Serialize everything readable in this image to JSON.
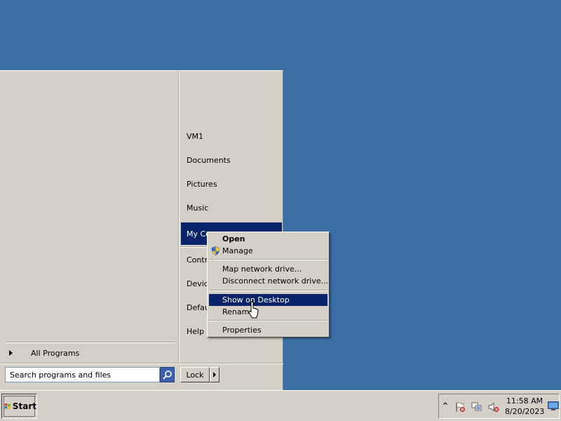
{
  "start_menu": {
    "all_programs_label": "All Programs",
    "right_items": [
      {
        "label": "VM1"
      },
      {
        "label": "Documents"
      },
      {
        "label": "Pictures"
      },
      {
        "label": "Music"
      },
      {
        "label": "My Co"
      },
      {
        "label": "Contr"
      },
      {
        "label": "Device"
      },
      {
        "label": "Defau"
      },
      {
        "label": "Help a"
      }
    ],
    "search_placeholder": "Search programs and files",
    "lock_label": "Lock"
  },
  "context_menu": {
    "items": [
      {
        "label": "Open"
      },
      {
        "label": "Manage",
        "icon": "shield-icon"
      },
      {
        "label": "Map network drive..."
      },
      {
        "label": "Disconnect network drive..."
      },
      {
        "label": "Show on Desktop"
      },
      {
        "label": "Rename"
      },
      {
        "label": "Properties"
      }
    ]
  },
  "taskbar": {
    "start_label": "Start",
    "clock_time": "11:58 AM",
    "clock_date": "8/20/2023",
    "tray_chevron": "^"
  },
  "colors": {
    "desktop": "#3a6ea5",
    "highlight": "#0a246a",
    "face": "#d4d0c8"
  }
}
